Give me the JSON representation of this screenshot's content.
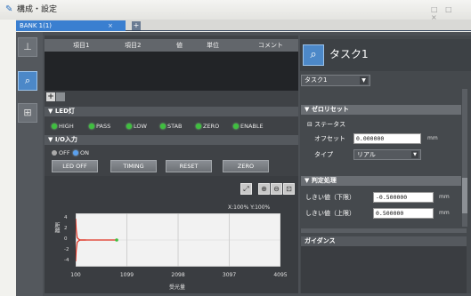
{
  "window": {
    "title": "構成・設定",
    "controls": "□ □ ×"
  },
  "tabs": [
    {
      "label": "BANK 1(1)",
      "close": "×"
    }
  ],
  "tab_add": "+",
  "table": {
    "headers": [
      "項目1",
      "項目2",
      "値",
      "単位",
      "コメント"
    ]
  },
  "led_section": {
    "title": "▼ LED灯",
    "indicators": [
      "HIGH",
      "PASS",
      "LOW",
      "STAB",
      "ZERO",
      "ENABLE"
    ]
  },
  "io_section": {
    "title": "▼ I/O入力",
    "radios": [
      {
        "label": "OFF",
        "selected": false
      },
      {
        "label": "ON",
        "selected": true
      }
    ],
    "buttons": [
      "LED OFF",
      "TIMING",
      "RESET",
      "ZERO"
    ]
  },
  "zoom_readout": "X:100% Y:100%",
  "chart_data": {
    "type": "line",
    "x_ticks": [
      "100",
      "1099",
      "2098",
      "3097",
      "4095"
    ],
    "y_ticks": [
      "4",
      "2",
      "0",
      "-2",
      "-4"
    ],
    "xlabel": "受光量",
    "ylabel": "距離",
    "series": [
      {
        "color": "#e03020",
        "x": [
          100,
          110,
          130,
          180,
          300,
          600,
          900
        ],
        "y": [
          -4,
          -2,
          -0.4,
          0,
          0,
          0,
          0
        ]
      },
      {
        "color": "#e03020",
        "x": [
          100,
          110,
          130,
          180,
          300
        ],
        "y": [
          4,
          2,
          0.4,
          0,
          0
        ]
      }
    ],
    "marker": {
      "x": 900,
      "y": 0,
      "color": "#3fbf3f"
    }
  },
  "task": {
    "title": "タスク1",
    "selector": "タスク1"
  },
  "zero_reset": {
    "title": "▼ ゼロリセット",
    "subsection": "⊟ ステータス",
    "offset_label": "オフセット",
    "offset_value": "0.000000",
    "offset_unit": "mm",
    "type_label": "タイプ",
    "type_value": "リアル"
  },
  "judgement": {
    "title": "▼ 判定処理",
    "lower_label": "しきい値（下限）",
    "lower_value": "-0.500000",
    "lower_unit": "mm",
    "upper_label": "しきい値（上限）",
    "upper_value": "0.500000",
    "upper_unit": "mm"
  },
  "guidance": {
    "title": "ガイダンス"
  },
  "colors": {
    "accent": "#3a7fd0",
    "led_on": "#3fbf3f",
    "plot_line": "#e03020"
  }
}
